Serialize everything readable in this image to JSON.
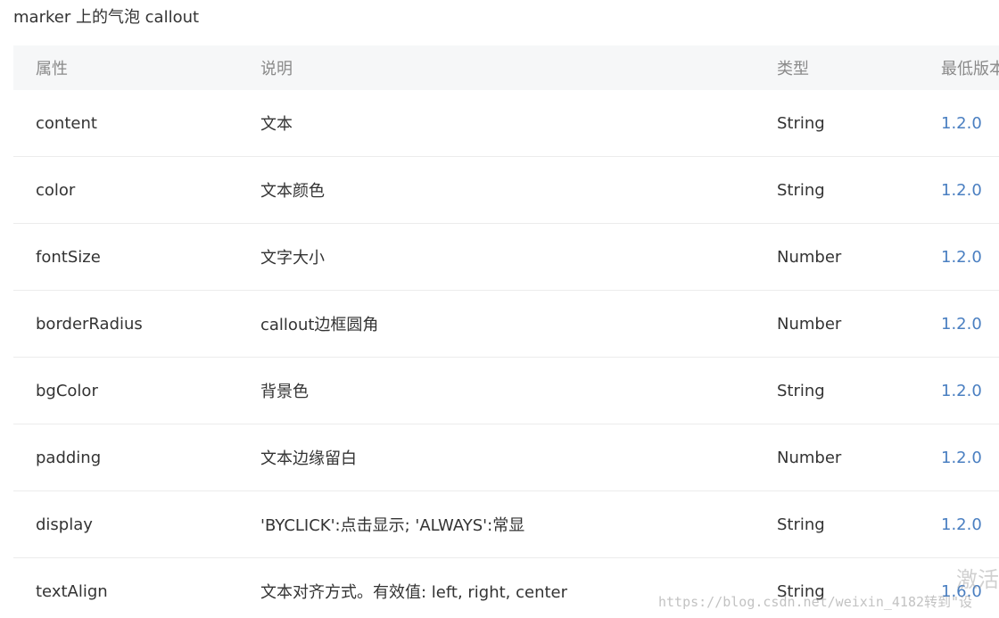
{
  "caption": "marker 上的气泡 callout",
  "table": {
    "headers": [
      "属性",
      "说明",
      "类型",
      "最低版本"
    ],
    "rows": [
      {
        "name": "content",
        "desc": "文本",
        "type": "String",
        "version": "1.2.0"
      },
      {
        "name": "color",
        "desc": "文本颜色",
        "type": "String",
        "version": "1.2.0"
      },
      {
        "name": "fontSize",
        "desc": "文字大小",
        "type": "Number",
        "version": "1.2.0"
      },
      {
        "name": "borderRadius",
        "desc": "callout边框圆角",
        "type": "Number",
        "version": "1.2.0"
      },
      {
        "name": "bgColor",
        "desc": "背景色",
        "type": "String",
        "version": "1.2.0"
      },
      {
        "name": "padding",
        "desc": "文本边缘留白",
        "type": "Number",
        "version": "1.2.0"
      },
      {
        "name": "display",
        "desc": "'BYCLICK':点击显示; 'ALWAYS':常显",
        "type": "String",
        "version": "1.2.0"
      },
      {
        "name": "textAlign",
        "desc": "文本对齐方式。有效值: left, right, center",
        "type": "String",
        "version": "1.6.0"
      }
    ]
  },
  "watermark": "https://blog.csdn.net/weixin_4182转到\"设",
  "activate_text": "激活",
  "colors": {
    "header_bg": "#f6f7f8",
    "version_link": "#4a7fc1",
    "row_border": "#ececec"
  }
}
